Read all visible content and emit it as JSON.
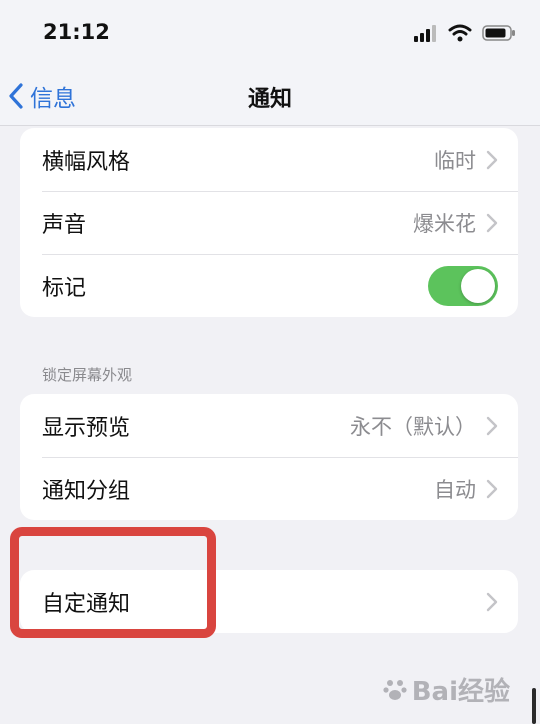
{
  "status_bar": {
    "time": "21:12"
  },
  "nav": {
    "back_label": "信息",
    "title": "通知"
  },
  "group1": {
    "rows": [
      {
        "label": "横幅风格",
        "value": "临时"
      },
      {
        "label": "声音",
        "value": "爆米花"
      },
      {
        "label": "标记",
        "toggle_on": true
      }
    ]
  },
  "lock_screen": {
    "header": "锁定屏幕外观",
    "rows": [
      {
        "label": "显示预览",
        "value": "永不（默认）"
      },
      {
        "label": "通知分组",
        "value": "自动"
      }
    ]
  },
  "custom": {
    "rows": [
      {
        "label": "自定通知"
      }
    ]
  },
  "watermark": {
    "text": "Bai经验"
  },
  "colors": {
    "accent": "#2f73d8",
    "toggle_on": "#5cc35c",
    "highlight": "#d9453f"
  }
}
